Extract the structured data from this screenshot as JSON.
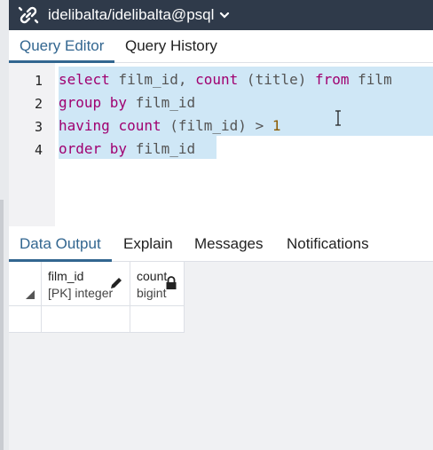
{
  "connection": {
    "title": "idelibalta/idelibalta@psql",
    "icon": "connection-icon"
  },
  "editor_tabs": [
    {
      "label": "Query Editor",
      "active": true
    },
    {
      "label": "Query History",
      "active": false
    }
  ],
  "editor": {
    "line_numbers": [
      "1",
      "2",
      "3",
      "4"
    ],
    "lines": [
      [
        {
          "t": "select",
          "k": "kw"
        },
        {
          "t": " film_id, "
        },
        {
          "t": "count",
          "k": "kw"
        },
        {
          "t": " (title) "
        },
        {
          "t": "from",
          "k": "kw"
        },
        {
          "t": " film"
        }
      ],
      [
        {
          "t": "group by",
          "k": "kw"
        },
        {
          "t": " film_id"
        }
      ],
      [
        {
          "t": "having",
          "k": "kw"
        },
        {
          "t": " "
        },
        {
          "t": "count",
          "k": "kw"
        },
        {
          "t": " (film_id) > "
        },
        {
          "t": "1",
          "k": "num"
        }
      ],
      [
        {
          "t": "order by",
          "k": "kw"
        },
        {
          "t": " film_id"
        }
      ]
    ]
  },
  "output_tabs": [
    {
      "label": "Data Output",
      "active": true
    },
    {
      "label": "Explain",
      "active": false
    },
    {
      "label": "Messages",
      "active": false
    },
    {
      "label": "Notifications",
      "active": false
    }
  ],
  "grid": {
    "columns": [
      {
        "name": "film_id",
        "type": "[PK] integer",
        "icon": "pencil-icon"
      },
      {
        "name": "count",
        "type": "bigint",
        "icon": "lock-icon"
      }
    ]
  },
  "colors": {
    "topbar": "#2f3a4a",
    "accent": "#326690",
    "selection": "#cfe7f6",
    "keyword": "#a00070"
  }
}
